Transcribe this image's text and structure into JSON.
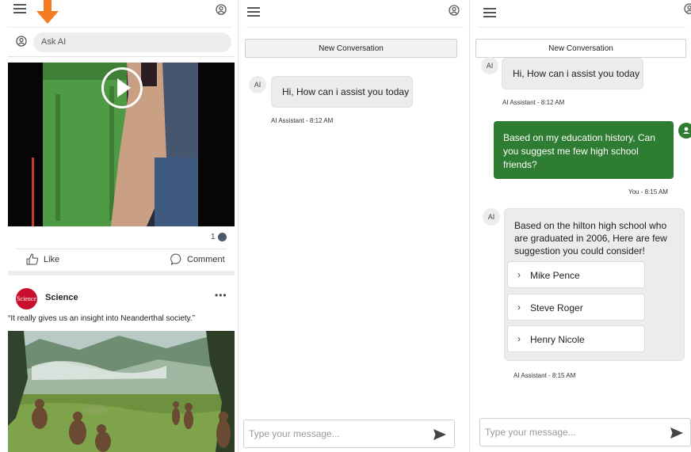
{
  "feed": {
    "ask_placeholder": "Ask AI",
    "post": {
      "comment_count": "1",
      "like_label": "Like",
      "comment_label": "Comment"
    },
    "source": {
      "logo_text": "Science",
      "name": "Science",
      "quote": "“It really gives us an insight into Neanderthal society.”"
    },
    "accent_color": "#f47b20"
  },
  "chat_empty": {
    "new_conversation_label": "New Conversation",
    "ai_badge": "AI",
    "greeting": "Hi, How can i assist you today",
    "greeting_meta": "AI Assistant - 8:12 AM",
    "composer_placeholder": "Type your message..."
  },
  "chat_thread": {
    "new_conversation_label": "New Conversation",
    "ai_badge": "AI",
    "greeting": "Hi, How can i assist you today",
    "greeting_meta": "AI Assistant - 8:12 AM",
    "user_message": "Based on my education history, Can you suggest me few high school friends?",
    "user_meta": "You - 8:15 AM",
    "ai_response": "Based on the hilton high school who are graduated in 2006, Here are few suggestion you could consider!",
    "suggestions": [
      "Mike Pence",
      "Steve Roger",
      "Henry Nicole"
    ],
    "response_meta": "AI Assistant - 8:15 AM",
    "composer_placeholder": "Type your message...",
    "user_bubble_color": "#2e7d32"
  }
}
